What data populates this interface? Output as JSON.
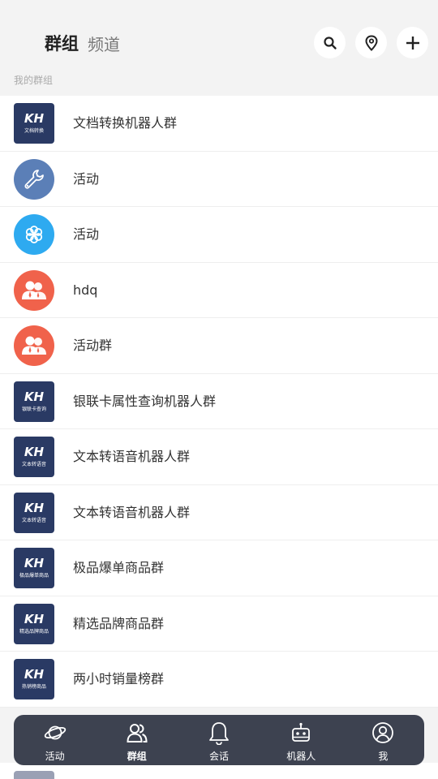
{
  "header": {
    "active_tab": "群组",
    "other_tab": "频道",
    "section_label": "我的群组",
    "buttons": [
      {
        "icon": "search-icon"
      },
      {
        "icon": "location-pin-icon"
      },
      {
        "icon": "plus-icon"
      }
    ]
  },
  "groups": [
    {
      "name": "文档转换机器人群",
      "avatar": "kh",
      "avatar_logo": "KH",
      "avatar_caption": "文档转换"
    },
    {
      "name": "活动",
      "avatar": "wrench",
      "color": "#5b7fb7"
    },
    {
      "name": "活动",
      "avatar": "flower",
      "color": "#2eaaf0"
    },
    {
      "name": "hdq",
      "avatar": "people",
      "color": "#f0624b"
    },
    {
      "name": "活动群",
      "avatar": "people",
      "color": "#f0624b"
    },
    {
      "name": "银联卡属性查询机器人群",
      "avatar": "kh",
      "avatar_logo": "KH",
      "avatar_caption": "银联卡查询"
    },
    {
      "name": "文本转语音机器人群",
      "avatar": "kh",
      "avatar_logo": "KH",
      "avatar_caption": "文本转语音"
    },
    {
      "name": "文本转语音机器人群",
      "avatar": "kh",
      "avatar_logo": "KH",
      "avatar_caption": "文本转语音"
    },
    {
      "name": "极品爆单商品群",
      "avatar": "kh",
      "avatar_logo": "KH",
      "avatar_caption": "极品爆单商品"
    },
    {
      "name": "精选品牌商品群",
      "avatar": "kh",
      "avatar_logo": "KH",
      "avatar_caption": "精选品牌商品"
    },
    {
      "name": "两小时销量榜群",
      "avatar": "kh",
      "avatar_logo": "KH",
      "avatar_caption": "热销榜商品"
    }
  ],
  "tabbar": {
    "items": [
      {
        "label": "活动",
        "icon": "planet-icon"
      },
      {
        "label": "群组",
        "icon": "group-icon",
        "active": true
      },
      {
        "label": "会话",
        "icon": "bell-icon"
      },
      {
        "label": "机器人",
        "icon": "robot-icon"
      },
      {
        "label": "我",
        "icon": "profile-icon"
      }
    ]
  },
  "colors": {
    "kh_avatar_bg": "#2a3a64",
    "tabbar_bg": "#3d4250",
    "header_bg": "#f3f3f3"
  }
}
